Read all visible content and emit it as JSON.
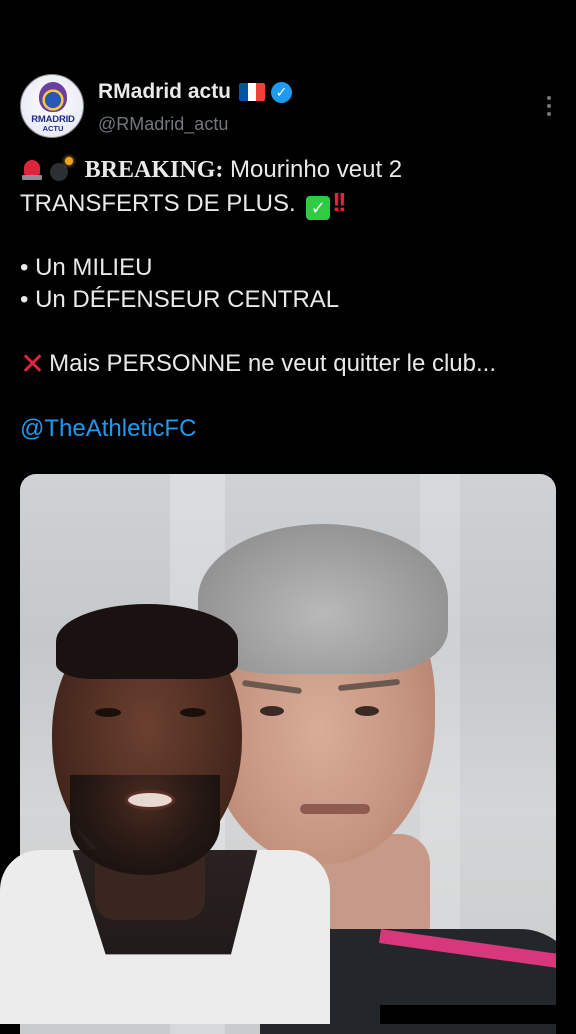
{
  "account": {
    "display_name": "RMadrid actu",
    "handle": "@RMadrid_actu",
    "avatar_text_1": "RMADRID",
    "avatar_text_2": "ACTU",
    "verified": true,
    "flag_colors": [
      "#0055a4",
      "#ffffff",
      "#ef4135"
    ]
  },
  "tweet": {
    "breaking_label": "BREAKING:",
    "line1_rest": " Mourinho veut 2",
    "line2": "TRANSFERTS DE PLUS.",
    "bullets": [
      "• Un MILIEU",
      "• Un DÉFENSEUR CENTRAL"
    ],
    "note": "Mais PERSONNE ne veut quitter le club...",
    "mention": "@TheAthleticFC"
  },
  "icons": {
    "siren": "police-light-icon",
    "bomb": "bomb-icon",
    "check": "check-mark-button-icon",
    "bangs": "double-exclamation-icon",
    "cross": "cross-mark-icon",
    "more": "more-options-icon",
    "verified": "verified-badge-icon"
  },
  "colors": {
    "background": "#000000",
    "text": "#e7e9ea",
    "muted": "#71767b",
    "link": "#1d9bf0",
    "alert_red": "#e0243b",
    "check_green": "#2ecc40"
  }
}
